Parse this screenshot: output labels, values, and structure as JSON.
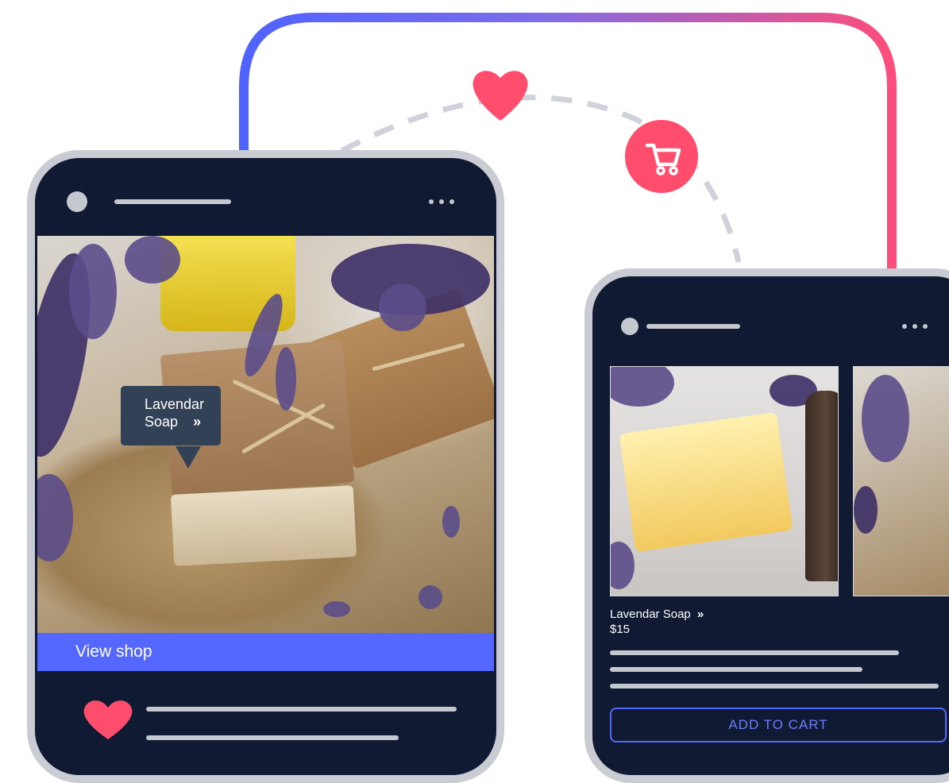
{
  "left_phone": {
    "tooltip": {
      "line1": "Lavendar",
      "line2": "Soap",
      "chevron": "»"
    },
    "view_shop_label": "View shop"
  },
  "right_phone": {
    "product_name": "Lavendar Soap",
    "product_chevron": "»",
    "product_price": "$15",
    "add_to_cart_label": "ADD TO CART"
  },
  "icons": [
    "heart-icon",
    "cart-icon",
    "menu-dots-icon",
    "chevron-double-right-icon"
  ],
  "colors": {
    "phone_body": "#111a33",
    "phone_frame": "#c9cdd3",
    "accent_blue": "#5468ff",
    "accent_pink": "#ff4d6d",
    "tooltip_bg": "#334157",
    "dashed_path": "#cfd3d9"
  }
}
